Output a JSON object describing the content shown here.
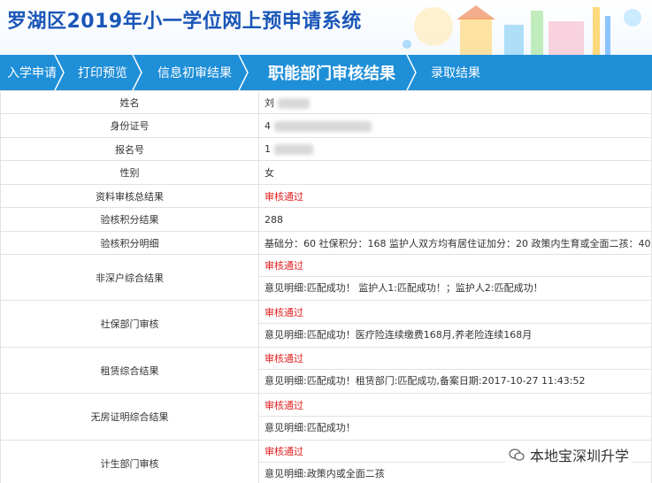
{
  "header": {
    "title": "罗湖区2019年小一学位网上预申请系统"
  },
  "nav": {
    "items": [
      {
        "label": "入学申请",
        "active": false
      },
      {
        "label": "打印预览",
        "active": false
      },
      {
        "label": "信息初审结果",
        "active": false
      },
      {
        "label": "职能部门审核结果",
        "active": true
      },
      {
        "label": "录取结果",
        "active": false
      }
    ]
  },
  "table": {
    "rows": [
      {
        "label": "姓名",
        "value": "刘"
      },
      {
        "label": "身份证号",
        "value": "4"
      },
      {
        "label": "报名号",
        "value": "1"
      },
      {
        "label": "性别",
        "value": "女"
      },
      {
        "label": "资料审核总结果",
        "value": "审核通过"
      },
      {
        "label": "验核积分结果",
        "value": "288"
      },
      {
        "label": "验核积分明细",
        "value": "基础分：60 社保积分：168 监护人双方均有居住证加分：20 政策内生育或全面二孩：40"
      },
      {
        "label": "非深户综合结果",
        "status": "审核通过",
        "detail": "意见明细:匹配成功！ 监护人1:匹配成功！；监护人2:匹配成功！"
      },
      {
        "label": "社保部门审核",
        "status": "审核通过",
        "detail": "意见明细:匹配成功！医疗险连续缴费168月,养老险连续168月"
      },
      {
        "label": "租赁综合结果",
        "status": "审核通过",
        "detail": "意见明细:匹配成功！租赁部门:匹配成功,备案日期:2017-10-27 11:43:52"
      },
      {
        "label": "无房证明综合结果",
        "status": "审核通过",
        "detail": "意见明细:匹配成功！"
      },
      {
        "label": "计生部门审核",
        "status": "审核通过",
        "detail": "意见明细:政策内或全面二孩"
      }
    ]
  },
  "watermark": {
    "text": "本地宝深圳升学"
  },
  "colors": {
    "brand_blue": "#1f8fd8",
    "title_blue": "#1a56b8",
    "status_red": "#e02020"
  }
}
